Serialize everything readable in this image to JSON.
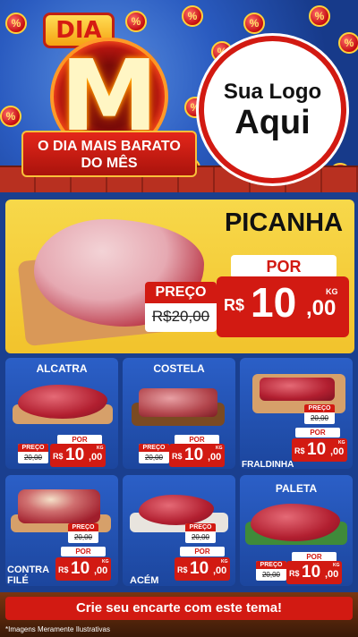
{
  "header": {
    "dia_label": "DIA",
    "m_letter": "M",
    "ribbon_line1": "O DIA MAIS BARATO",
    "ribbon_line2": "DO MÊS",
    "logo_line1": "Sua Logo",
    "logo_line2": "Aqui",
    "coin_symbol": "%"
  },
  "featured": {
    "name": "PICANHA",
    "por_label": "POR",
    "preco_label": "PREÇO",
    "old_price": "R$20,00",
    "currency": "R$",
    "price_int": "10",
    "price_dec": ",00",
    "unit": "KG"
  },
  "products": [
    {
      "name": "ALCATRA",
      "preco_label": "PREÇO",
      "old_price": "20,00",
      "por_label": "POR",
      "currency": "R$",
      "price_int": "10",
      "price_dec": ",00",
      "unit": "KG"
    },
    {
      "name": "COSTELA",
      "preco_label": "PREÇO",
      "old_price": "20,00",
      "por_label": "POR",
      "currency": "R$",
      "price_int": "10",
      "price_dec": ",00",
      "unit": "KG"
    },
    {
      "name": "FRALDINHA",
      "preco_label": "PREÇO",
      "old_price": "20,00",
      "por_label": "POR",
      "currency": "R$",
      "price_int": "10",
      "price_dec": ",00",
      "unit": "KG"
    },
    {
      "name": "CONTRA FILÉ",
      "name_line1": "CONTRA",
      "name_line2": "FILÉ",
      "preco_label": "PREÇO",
      "old_price": "20,00",
      "por_label": "POR",
      "currency": "R$",
      "price_int": "10",
      "price_dec": ",00",
      "unit": "KG"
    },
    {
      "name": "ACÉM",
      "preco_label": "PREÇO",
      "old_price": "20,00",
      "por_label": "POR",
      "currency": "R$",
      "price_int": "10",
      "price_dec": ",00",
      "unit": "KG"
    },
    {
      "name": "PALETA",
      "preco_label": "PREÇO",
      "old_price": "20,00",
      "por_label": "POR",
      "currency": "R$",
      "price_int": "10",
      "price_dec": ",00",
      "unit": "KG"
    }
  ],
  "footer": {
    "cta": "Crie seu encarte com este tema!",
    "disclaimer": "*Imagens Meramente Ilustrativas"
  },
  "colors": {
    "accent_red": "#d21a12",
    "featured_yellow": "#f2c32c",
    "card_blue": "#1c469e"
  }
}
